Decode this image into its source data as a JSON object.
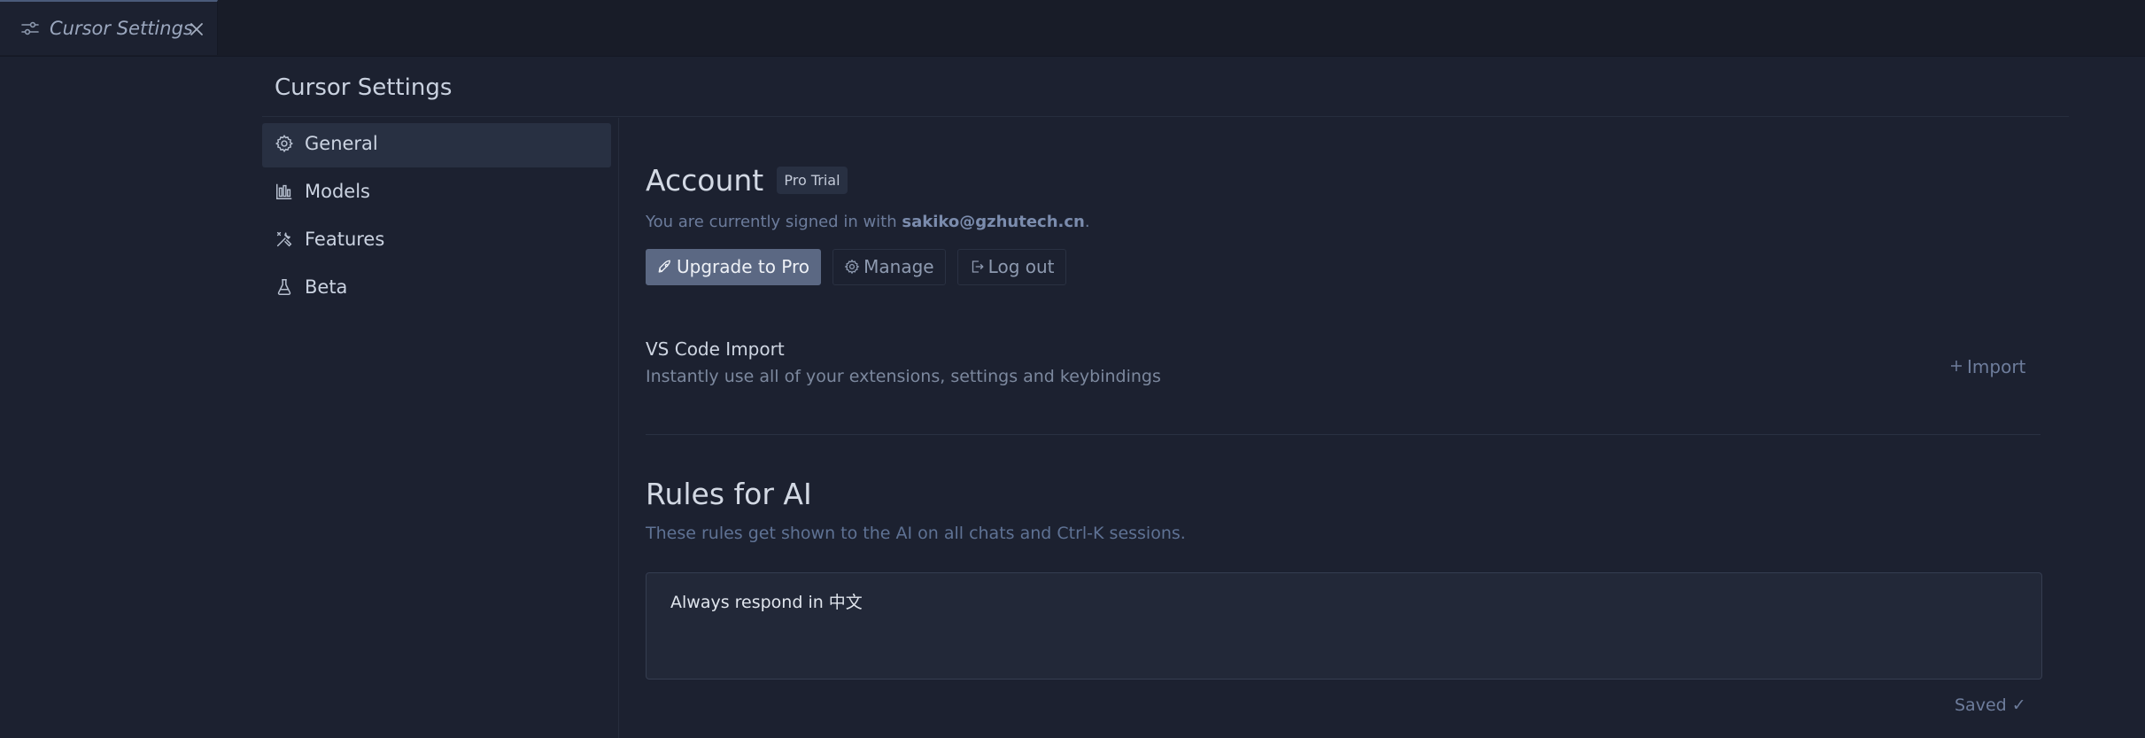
{
  "tab": {
    "title": "Cursor Settings",
    "icon": "settings-sliders-icon",
    "close_icon": "close-icon"
  },
  "page": {
    "title": "Cursor Settings"
  },
  "sidebar": {
    "items": [
      {
        "label": "General",
        "icon": "gear-icon",
        "active": true
      },
      {
        "label": "Models",
        "icon": "bar-chart-icon",
        "active": false
      },
      {
        "label": "Features",
        "icon": "tools-icon",
        "active": false
      },
      {
        "label": "Beta",
        "icon": "flask-icon",
        "active": false
      }
    ]
  },
  "account": {
    "heading": "Account",
    "badge": "Pro Trial",
    "signed_prefix": "You are currently signed in with ",
    "email": "sakiko@gzhutech.cn",
    "signed_suffix": ".",
    "buttons": {
      "upgrade": "Upgrade to Pro",
      "manage": "Manage",
      "logout": "Log out"
    }
  },
  "vscode_import": {
    "title": "VS Code Import",
    "description": "Instantly use all of your extensions, settings and keybindings",
    "button": "Import"
  },
  "rules": {
    "heading": "Rules for AI",
    "description": "These rules get shown to the AI on all chats and Ctrl-K sessions.",
    "value": "Always respond in 中文",
    "status": "Saved ✓"
  },
  "colors": {
    "background": "#1c2130",
    "tabbar": "#181c28",
    "active_item": "#283042",
    "primary_button": "#5b6883",
    "muted_link": "#6e7d9c"
  }
}
